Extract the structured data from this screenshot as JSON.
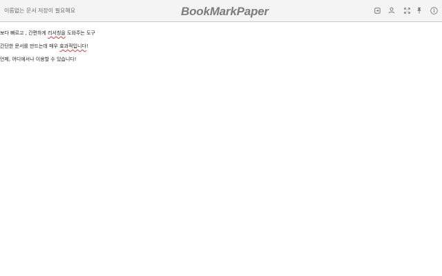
{
  "header": {
    "doc_title": "이름없는 문서",
    "save_status": "저장이 필요해요",
    "brand": "BookMarkPaper"
  },
  "toolbar": {
    "icons": [
      "export-icon",
      "user-icon",
      "fullscreen-icon",
      "pin-icon",
      "info-icon"
    ]
  },
  "editor": {
    "lines": [
      {
        "before": "보다 빠르고 , 간편하게 ",
        "typo": "리서칭을",
        "after": " 도와주는 도구"
      },
      {
        "before": "간단한 문서를 만드는데 매우 ",
        "typo": "효과적입니다",
        "after": "!"
      },
      {
        "before": "언제, 어디에서나 이용할 수 있습니다!",
        "typo": "",
        "after": ""
      }
    ]
  },
  "colors": {
    "topbar_bg": "#f4f4f4",
    "brand": "#7b7b7b",
    "icon": "#777777",
    "spellcheck": "#d23a3a"
  }
}
